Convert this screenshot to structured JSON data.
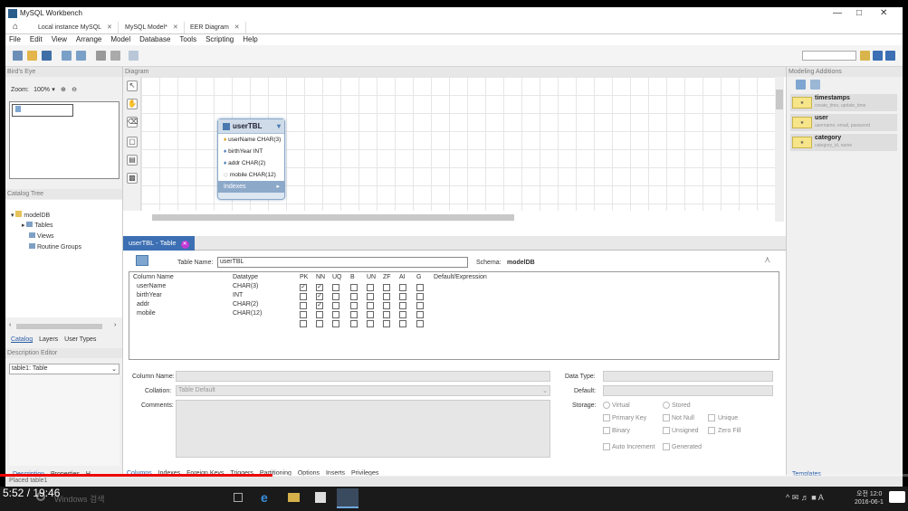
{
  "app": {
    "title": "MySQL Workbench"
  },
  "tabs": [
    {
      "label": "Local instance MySQL"
    },
    {
      "label": "MySQL Model*"
    },
    {
      "label": "EER Diagram"
    }
  ],
  "menu": [
    "File",
    "Edit",
    "View",
    "Arrange",
    "Model",
    "Database",
    "Tools",
    "Scripting",
    "Help"
  ],
  "birds_eye": {
    "title": "Bird's Eye",
    "zoom_label": "Zoom:",
    "zoom_value": "100%"
  },
  "catalog": {
    "title": "Catalog Tree",
    "root": "modelDB",
    "items": [
      "Tables",
      "Views",
      "Routine Groups"
    ],
    "tabs": [
      "Catalog",
      "Layers",
      "User Types"
    ]
  },
  "description": {
    "title": "Description Editor",
    "selected": "table1: Table"
  },
  "left_bottom_tabs": [
    "Description",
    "Properties",
    "H"
  ],
  "diagram": {
    "title": "Diagram"
  },
  "entity": {
    "name": "userTBL",
    "columns": [
      "userName CHAR(3)",
      "birthYear INT",
      "addr CHAR(2)",
      "mobile CHAR(12)"
    ],
    "indexes_label": "Indexes"
  },
  "editor": {
    "tab_label": "userTBL - Table",
    "table_name_label": "Table Name:",
    "table_name": "userTBL",
    "schema_label": "Schema:",
    "schema": "modelDB",
    "headers": [
      "Column Name",
      "Datatype",
      "PK",
      "NN",
      "UQ",
      "B",
      "UN",
      "ZF",
      "AI",
      "G",
      "Default/Expression"
    ],
    "rows": [
      {
        "name": "userName",
        "type": "CHAR(3)",
        "pk": true,
        "nn": true
      },
      {
        "name": "birthYear",
        "type": "INT",
        "pk": false,
        "nn": true
      },
      {
        "name": "addr",
        "type": "CHAR(2)",
        "pk": false,
        "nn": true
      },
      {
        "name": "mobile",
        "type": "CHAR(12)",
        "pk": false,
        "nn": false
      },
      {
        "name": "",
        "type": "",
        "pk": false,
        "nn": false
      }
    ],
    "detail": {
      "column_name_label": "Column Name:",
      "collation_label": "Collation:",
      "collation_value": "Table Default",
      "comments_label": "Comments:",
      "data_type_label": "Data Type:",
      "default_label": "Default:",
      "storage_label": "Storage:",
      "storage": [
        "Virtual",
        "Stored"
      ],
      "flags": [
        "Primary Key",
        "Not Null",
        "Unique",
        "Binary",
        "Unsigned",
        "Zero Fill",
        "Auto Increment",
        "Generated"
      ]
    },
    "bottom_tabs": [
      "Columns",
      "Indexes",
      "Foreign Keys",
      "Triggers",
      "Partitioning",
      "Options",
      "Inserts",
      "Privileges"
    ]
  },
  "modeling": {
    "title": "Modeling Additions",
    "items": [
      {
        "name": "timestamps",
        "desc": "create_time, update_time"
      },
      {
        "name": "user",
        "desc": "username, email, password"
      },
      {
        "name": "category",
        "desc": "category_id, name"
      }
    ],
    "templates_tab": "Templates"
  },
  "status": {
    "text": "Placed table1"
  },
  "video": {
    "time": "5:52 / 19:46",
    "progress": 0.3
  },
  "taskbar": {
    "search": "Windows 검색",
    "clock_time": "오전 12:0",
    "clock_date": "2016-06-1",
    "lang": "A"
  },
  "colors": {
    "accent": "#3c6fb3",
    "entity_header": "#cfdbe9",
    "progress": "#e00000"
  }
}
